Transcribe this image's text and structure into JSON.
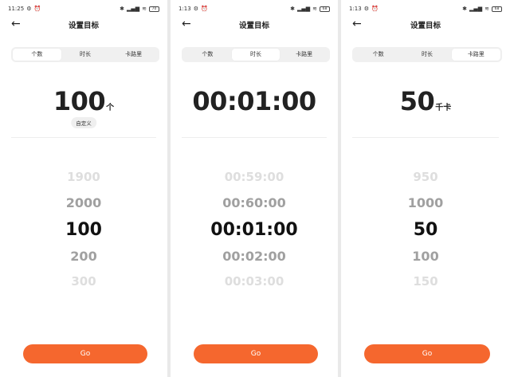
{
  "colors": {
    "accent": "#f5672e",
    "segment_bg": "#f0f0f0",
    "active_tab_bg": "#ffffff"
  },
  "screens": [
    {
      "status": {
        "time": "11:25",
        "battery": "70"
      },
      "title": "设置目标",
      "tabs": [
        "个数",
        "时长",
        "卡路里"
      ],
      "active_tab": 0,
      "value": "100",
      "unit": "个",
      "custom_label": "自定义",
      "picker": [
        "1900",
        "2000",
        "100",
        "200",
        "300"
      ],
      "go": "Go"
    },
    {
      "status": {
        "time": "1:13",
        "battery": "68"
      },
      "title": "设置目标",
      "tabs": [
        "个数",
        "时长",
        "卡路里"
      ],
      "active_tab": 1,
      "value": "00:01:00",
      "unit": "",
      "picker": [
        "00:59:00",
        "00:60:00",
        "00:01:00",
        "00:02:00",
        "00:03:00"
      ],
      "go": "Go"
    },
    {
      "status": {
        "time": "1:13",
        "battery": "68"
      },
      "title": "设置目标",
      "tabs": [
        "个数",
        "时长",
        "卡路里"
      ],
      "active_tab": 2,
      "value": "50",
      "unit": "千卡",
      "picker": [
        "950",
        "1000",
        "50",
        "100",
        "150"
      ],
      "go": "Go"
    }
  ]
}
